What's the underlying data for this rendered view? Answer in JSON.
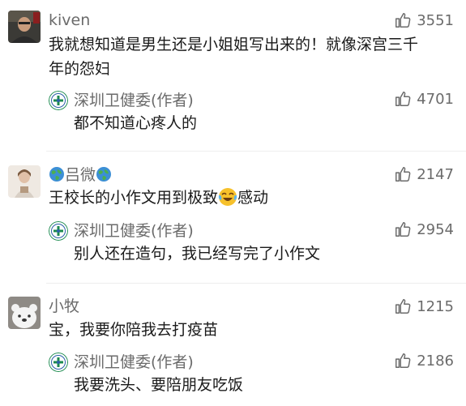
{
  "comments": [
    {
      "author": "kiven",
      "likes": "3551",
      "text_line1": "我就想知道是男生还是小姐姐写出来的！就像深宫三千",
      "text_line2": "年的怨妇",
      "reply": {
        "author": "深圳卫健委(作者)",
        "likes": "4701",
        "text": "都不知道心疼人的"
      }
    },
    {
      "author": "吕微",
      "likes": "2147",
      "text_before_emoji": "王校长的小作文用到极致",
      "text_after_emoji": "感动",
      "reply": {
        "author": "深圳卫健委(作者)",
        "likes": "2954",
        "text": "别人还在造句，我已经写完了小作文"
      }
    },
    {
      "author": "小牧",
      "likes": "1215",
      "text": "宝，我要你陪我去打疫苗",
      "reply": {
        "author": "深圳卫健委(作者)",
        "likes": "2186",
        "text": "我要洗头、要陪朋友吃饭"
      }
    }
  ],
  "icons": {
    "like": "thumbs-up-icon",
    "globe": "globe-icon",
    "emoji": "crying-laughing-emoji-icon",
    "author_avatar": "health-commission-logo-icon"
  },
  "colors": {
    "text": "#1a1a1a",
    "secondary": "#6b6b6b",
    "logo_green": "#1b8a4e",
    "logo_blue": "#2a5fa8"
  }
}
